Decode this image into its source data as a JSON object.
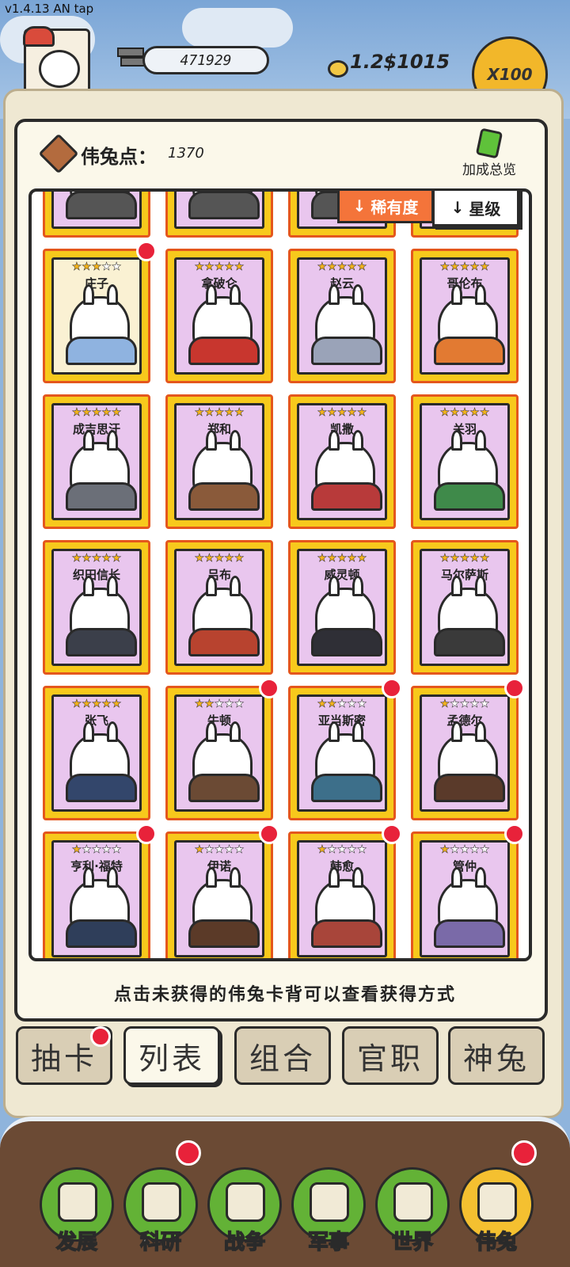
{
  "status": {
    "version": "v1.4.13 AN tap"
  },
  "resources": {
    "silver": "471929",
    "money": "1.2$1015",
    "multiplier": "X100"
  },
  "points": {
    "label": "伟兔点：",
    "value": "1370"
  },
  "bonus": {
    "label": "加成总览",
    "icon": "note-icon"
  },
  "sort": {
    "rarity": "稀有度",
    "star": "星级"
  },
  "partial_row": [
    "",
    "",
    "",
    ""
  ],
  "cards": [
    {
      "name": "庄子",
      "stars": 3,
      "max": 5,
      "badge": true,
      "special": true,
      "outfit": "#8fb3e0"
    },
    {
      "name": "拿破仑",
      "stars": 5,
      "max": 5,
      "badge": false,
      "outfit": "#c8362e"
    },
    {
      "name": "赵云",
      "stars": 5,
      "max": 5,
      "badge": false,
      "outfit": "#9aa3b8"
    },
    {
      "name": "哥伦布",
      "stars": 5,
      "max": 5,
      "badge": false,
      "outfit": "#e27a32"
    },
    {
      "name": "成吉思汗",
      "stars": 5,
      "max": 5,
      "badge": false,
      "outfit": "#6b6f78"
    },
    {
      "name": "郑和",
      "stars": 5,
      "max": 5,
      "badge": false,
      "outfit": "#8a5a3a"
    },
    {
      "name": "凯撒",
      "stars": 5,
      "max": 5,
      "badge": false,
      "outfit": "#b83a3a"
    },
    {
      "name": "关羽",
      "stars": 5,
      "max": 5,
      "badge": false,
      "outfit": "#3f8a4a"
    },
    {
      "name": "织田信长",
      "stars": 5,
      "max": 5,
      "badge": false,
      "outfit": "#3b3f4a"
    },
    {
      "name": "吕布",
      "stars": 5,
      "max": 5,
      "badge": false,
      "outfit": "#b8432f"
    },
    {
      "name": "威灵顿",
      "stars": 5,
      "max": 5,
      "badge": false,
      "outfit": "#2f2f36"
    },
    {
      "name": "马尔萨斯",
      "stars": 5,
      "max": 5,
      "badge": false,
      "outfit": "#3a3a3a"
    },
    {
      "name": "张飞",
      "stars": 5,
      "max": 5,
      "badge": false,
      "outfit": "#33466b"
    },
    {
      "name": "牛顿",
      "stars": 2,
      "max": 5,
      "badge": true,
      "outfit": "#6b4a34"
    },
    {
      "name": "亚当斯密",
      "stars": 2,
      "max": 5,
      "badge": true,
      "outfit": "#3d6f8a"
    },
    {
      "name": "孟德尔",
      "stars": 1,
      "max": 5,
      "badge": true,
      "outfit": "#5a3a2a"
    },
    {
      "name": "亨利·福特",
      "stars": 1,
      "max": 5,
      "badge": true,
      "outfit": "#2f3e5a"
    },
    {
      "name": "伊诺",
      "stars": 1,
      "max": 5,
      "badge": true,
      "outfit": "#5b3a28"
    },
    {
      "name": "韩愈",
      "stars": 1,
      "max": 5,
      "badge": true,
      "outfit": "#a8453a"
    },
    {
      "name": "管仲",
      "stars": 1,
      "max": 5,
      "badge": true,
      "outfit": "#7a6aa8"
    }
  ],
  "hint": "点击未获得的伟兔卡背可以查看获得方式",
  "tabs": [
    {
      "label": "抽卡",
      "badge": true,
      "active": false
    },
    {
      "label": "列表",
      "badge": false,
      "active": true
    },
    {
      "label": "组合",
      "badge": false,
      "active": false
    },
    {
      "label": "官职",
      "badge": false,
      "active": false
    },
    {
      "label": "神兔",
      "badge": false,
      "active": false
    }
  ],
  "nav": [
    {
      "label": "发展",
      "icon": "arrow-icon",
      "badge": false,
      "active": false
    },
    {
      "label": "科研",
      "icon": "flask-icon",
      "badge": true,
      "active": false
    },
    {
      "label": "战争",
      "icon": "swords-icon",
      "badge": false,
      "active": false
    },
    {
      "label": "军事",
      "icon": "helmet-icon",
      "badge": false,
      "active": false
    },
    {
      "label": "世界",
      "icon": "globe-icon",
      "badge": false,
      "active": false
    },
    {
      "label": "伟兔",
      "icon": "bunny-icon",
      "badge": true,
      "active": true
    }
  ]
}
